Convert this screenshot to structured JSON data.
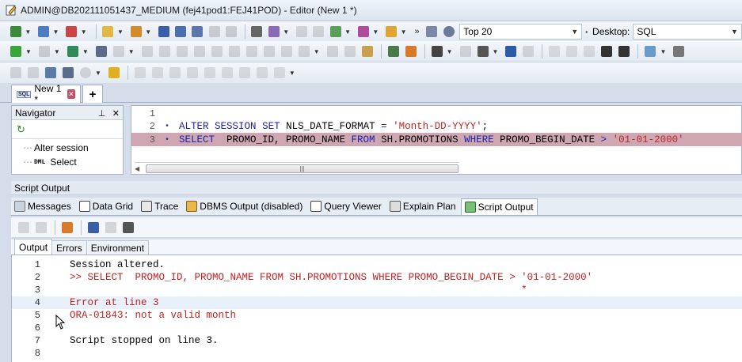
{
  "window": {
    "title": "ADMIN@DB202111051437_MEDIUM (fej41pod1:FEJ41POD) - Editor (New 1 *)"
  },
  "toolbar": {
    "rows_combo": "Top 20",
    "desktop_label": "Desktop:",
    "desktop_value": "SQL"
  },
  "tabs": {
    "editor_tab": "New 1 *"
  },
  "navigator": {
    "title": "Navigator",
    "items": [
      {
        "label": "Alter session"
      },
      {
        "label": "Select",
        "prefix": "DML"
      }
    ]
  },
  "editor": {
    "lines": [
      {
        "num": "1",
        "text": ""
      },
      {
        "num": "2",
        "text": "ALTER SESSION SET NLS_DATE_FORMAT = 'Month-DD-YYYY';"
      },
      {
        "num": "3",
        "text": "SELECT  PROMO_ID, PROMO_NAME FROM SH.PROMOTIONS WHERE PROMO_BEGIN_DATE > '01-01-2000'"
      }
    ]
  },
  "output_panel": {
    "title": "Script Output",
    "tabs": [
      "Messages",
      "Data Grid",
      "Trace",
      "DBMS Output (disabled)",
      "Query Viewer",
      "Explain Plan",
      "Script Output"
    ],
    "subtabs": [
      "Output",
      "Errors",
      "Environment"
    ],
    "lines": [
      {
        "num": "1",
        "text": "Session altered."
      },
      {
        "num": "2",
        "text": ">> SELECT  PROMO_ID, PROMO_NAME FROM SH.PROMOTIONS WHERE PROMO_BEGIN_DATE > '01-01-2000'"
      },
      {
        "num": "3",
        "text": "                                                                            *"
      },
      {
        "num": "4",
        "text": "Error at line 3"
      },
      {
        "num": "5",
        "text": "ORA-01843: not a valid month"
      },
      {
        "num": "6",
        "text": ""
      },
      {
        "num": "7",
        "text": "Script stopped on line 3."
      },
      {
        "num": "8",
        "text": ""
      }
    ]
  },
  "colors": {
    "error_text": "#c0201e",
    "keyword": "#1b22a8",
    "string": "#b8292a",
    "highlight": "#cfa7b3"
  }
}
